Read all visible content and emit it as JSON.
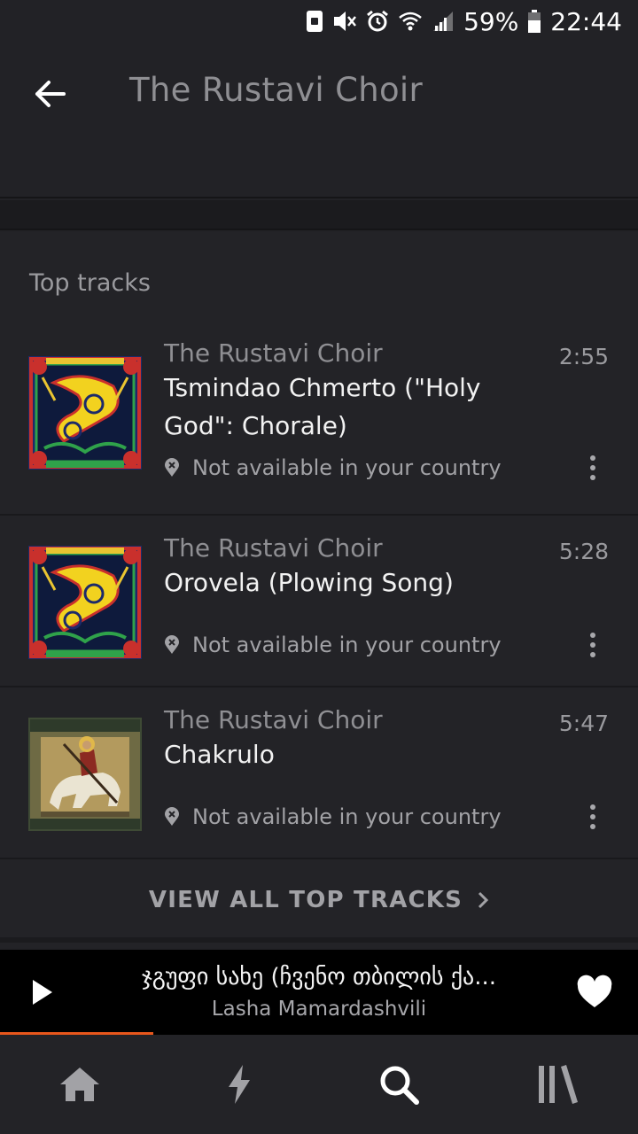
{
  "status_bar": {
    "battery": "59%",
    "time": "22:44"
  },
  "header": {
    "title": "The Rustavi Choir",
    "back_icon": "arrow-left-icon"
  },
  "section": {
    "title": "Top tracks"
  },
  "tracks": [
    {
      "artist": "The Rustavi Choir",
      "title": "Tsmindao Chmerto (\"Holy God\": Chorale)",
      "duration": "2:55",
      "availability": "Not available in your country",
      "artwork": "georgian-voices-album-cover"
    },
    {
      "artist": "The Rustavi Choir",
      "title": "Orovela (Plowing Song)",
      "duration": "5:28",
      "availability": "Not available in your country",
      "artwork": "georgian-voices-album-cover"
    },
    {
      "artist": "The Rustavi Choir",
      "title": "Chakrulo",
      "duration": "5:47",
      "availability": "Not available in your country",
      "artwork": "rustavi-choir-album-cover"
    }
  ],
  "view_all": {
    "label": "VIEW ALL TOP TRACKS"
  },
  "now_playing": {
    "title": "ჯგუფი სახე (ჩვენო თბილის ქა...",
    "artist": "Lasha Mamardashvili",
    "progress_fraction": 0.24
  },
  "nav": {
    "items": [
      "home-icon",
      "stream-icon",
      "search-icon",
      "library-icon"
    ],
    "active_index": 2
  },
  "colors": {
    "background": "#232327",
    "accent": "#e8571c",
    "muted_text": "#8f8f93"
  }
}
